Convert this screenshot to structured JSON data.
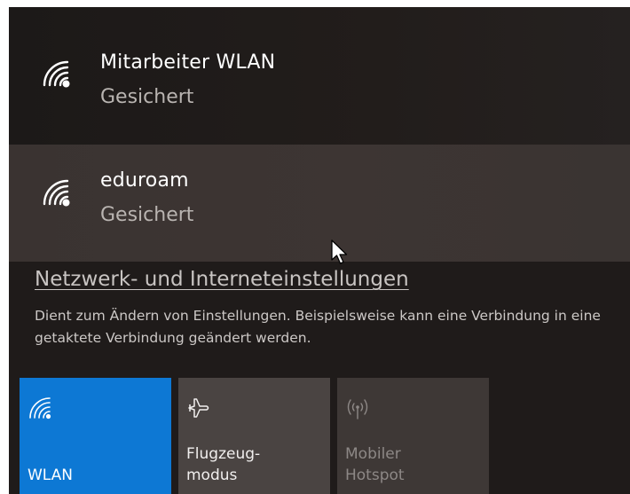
{
  "networks": [
    {
      "ssid": "Mitarbeiter WLAN",
      "status": "Gesichert",
      "icon": "wifi-secured-icon"
    },
    {
      "ssid": "eduroam",
      "status": "Gesichert",
      "icon": "wifi-secured-icon"
    }
  ],
  "settings": {
    "link_label": "Netzwerk- und Interneteinstellungen",
    "description": "Dient zum Ändern von Einstellungen. Beispielsweise kann eine Verbindung in eine getaktete Verbindung geändert werden."
  },
  "quick_actions": {
    "wlan": {
      "label": "WLAN",
      "icon": "wifi-icon",
      "active": true
    },
    "airplane": {
      "label_line1": "Flugzeug-",
      "label_line2": "modus",
      "icon": "airplane-icon",
      "active": false
    },
    "hotspot": {
      "label_line1": "Mobiler",
      "label_line2": "Hotspot",
      "icon": "hotspot-icon",
      "active": false,
      "disabled": true
    }
  },
  "colors": {
    "accent": "#0d78d4",
    "panel_bg": "#1f1b1a",
    "hover_bg": "#3a3331"
  }
}
